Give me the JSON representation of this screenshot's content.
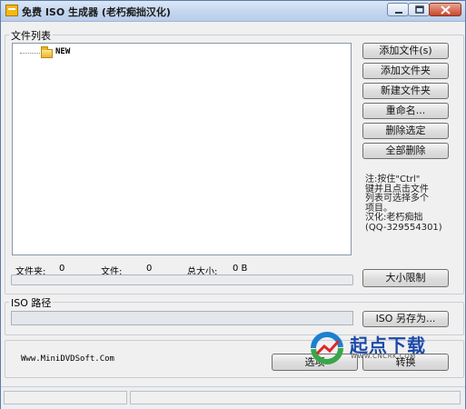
{
  "window": {
    "title": "免费 ISO 生成器 (老朽痴拙汉化)",
    "controls": [
      "minimize-icon",
      "maximize-icon",
      "close-icon"
    ]
  },
  "file_list": {
    "group_label": "文件列表",
    "tree_root": "NEW"
  },
  "buttons": {
    "add_files": "添加文件(s)",
    "add_folder": "添加文件夹",
    "new_folder": "新建文件夹",
    "rename": "重命名...",
    "delete_selected": "删除选定",
    "delete_all": "全部删除",
    "size_limit": "大小限制",
    "save_iso_as": "ISO 另存为...",
    "options": "选项",
    "convert": "转换"
  },
  "note": "注:按住\"Ctrl\"\n键并且点击文件\n列表可选择多个\n项目。\n汉化:老朽痴拙\n(QQ-329554301)",
  "stats": {
    "folders_label": "文件夹:",
    "folders_value": "0",
    "files_label": "文件:",
    "files_value": "0",
    "total_size_label": "总大小:",
    "total_size_value": "0 B",
    "progress": 0
  },
  "iso_path": {
    "group_label": "ISO 路径",
    "value": ""
  },
  "footer": {
    "website": "Www.MiniDVDSoft.Com"
  },
  "watermark": {
    "text": "起点下载",
    "sub": "WWW.CNCRK.COM"
  },
  "colors": {
    "accent": "#5a7ca6",
    "watermark_blue": "#1c4aa8",
    "watermark_green": "#3aa64a"
  }
}
